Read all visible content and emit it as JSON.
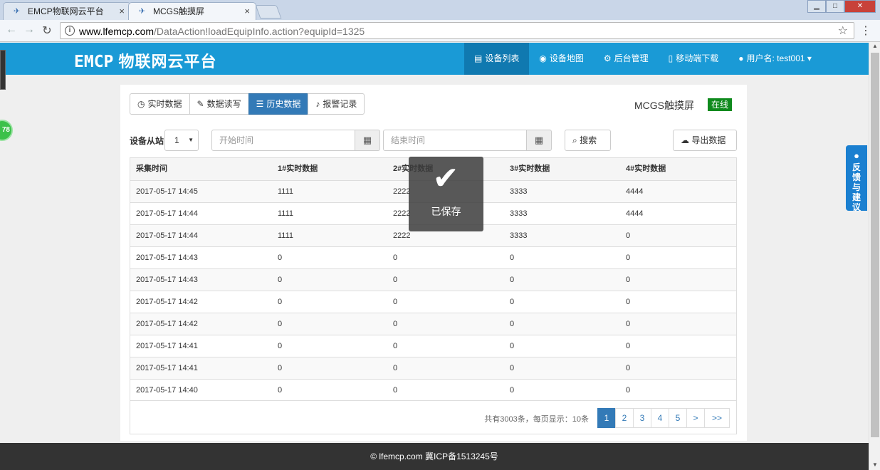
{
  "browser": {
    "tabs": [
      {
        "label": "EMCP物联网云平台"
      },
      {
        "label": "MCGS触摸屏"
      }
    ],
    "tab_close": "×",
    "url_host": "www.lfemcp.com",
    "url_path": "/DataAction!loadEquipInfo.action?equipId=1325",
    "win_min": "▁",
    "win_max": "□",
    "win_close": "✕"
  },
  "header": {
    "logo_en": "EMCP",
    "logo_cn": "物联网云平台",
    "nav": [
      {
        "label": "设备列表",
        "icon": "list-icon"
      },
      {
        "label": "设备地图",
        "icon": "globe-icon"
      },
      {
        "label": "后台管理",
        "icon": "gears-icon"
      },
      {
        "label": "移动端下载",
        "icon": "mobile-icon"
      },
      {
        "label": "用户名: test001",
        "icon": "user-icon"
      }
    ]
  },
  "side": {
    "badge": "78",
    "feedback": "反馈与建议"
  },
  "panel": {
    "tabs": [
      {
        "label": "实时数据",
        "icon": "clock-icon"
      },
      {
        "label": "数据读写",
        "icon": "pencil-icon"
      },
      {
        "label": "历史数据",
        "icon": "table-icon"
      },
      {
        "label": "报警记录",
        "icon": "bell-icon"
      }
    ],
    "device_name": "MCGS触摸屏",
    "status": "在线",
    "status_color": "#0f8a1d"
  },
  "filter": {
    "label": "设备从站",
    "station": "1",
    "start_placeholder": "开始时间",
    "end_placeholder": "结束时间",
    "search_label": "搜索",
    "export_label": "导出数据"
  },
  "table": {
    "headers": [
      "采集时间",
      "1#实时数据",
      "2#实时数据",
      "3#实时数据",
      "4#实时数据"
    ],
    "rows": [
      [
        "2017-05-17 14:45",
        "1111",
        "2222",
        "3333",
        "4444"
      ],
      [
        "2017-05-17 14:44",
        "1111",
        "2222",
        "3333",
        "4444"
      ],
      [
        "2017-05-17 14:44",
        "1111",
        "2222",
        "3333",
        "0"
      ],
      [
        "2017-05-17 14:43",
        "0",
        "0",
        "0",
        "0"
      ],
      [
        "2017-05-17 14:43",
        "0",
        "0",
        "0",
        "0"
      ],
      [
        "2017-05-17 14:42",
        "0",
        "0",
        "0",
        "0"
      ],
      [
        "2017-05-17 14:42",
        "0",
        "0",
        "0",
        "0"
      ],
      [
        "2017-05-17 14:41",
        "0",
        "0",
        "0",
        "0"
      ],
      [
        "2017-05-17 14:41",
        "0",
        "0",
        "0",
        "0"
      ],
      [
        "2017-05-17 14:40",
        "0",
        "0",
        "0",
        "0"
      ]
    ]
  },
  "pager": {
    "summary": "共有3003条，每页显示：10条",
    "pages": [
      "1",
      "2",
      "3",
      "4",
      "5",
      ">",
      ">>"
    ],
    "current": "1"
  },
  "toast": {
    "message": "已保存"
  },
  "footer": {
    "text": "© lfemcp.com 冀ICP备1513245号"
  },
  "colors": {
    "brand": "#1a9ad6",
    "primary": "#337ab7",
    "footer": "#333333"
  }
}
